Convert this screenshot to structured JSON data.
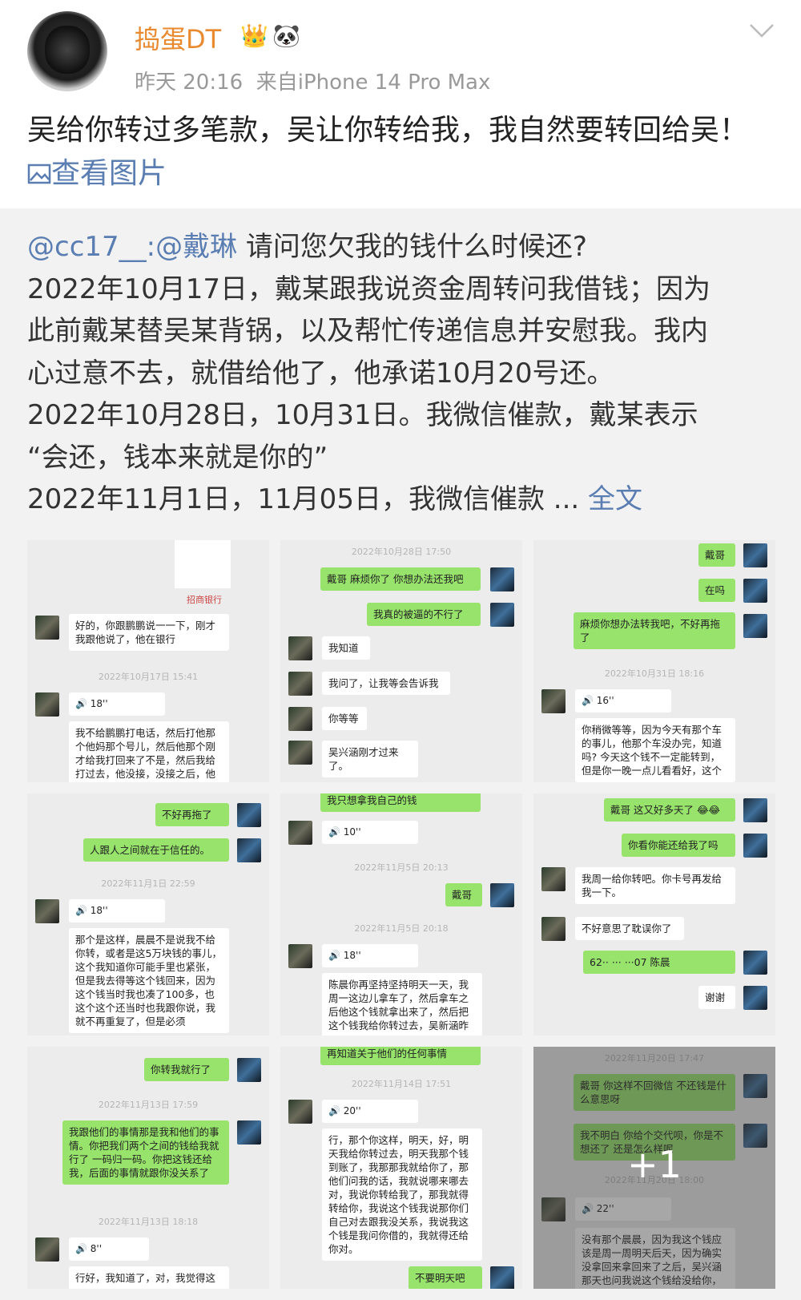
{
  "user": {
    "name": "捣蛋DT",
    "time": "昨天 20:16",
    "source": "来自iPhone 14 Pro Max"
  },
  "post": {
    "text": "吴给你转过多笔款，吴让你转给我，我自然要转回给吴！",
    "view_images": "查看图片"
  },
  "repost": {
    "mention": "@cc17__",
    "mention2": ":@戴琳",
    "line0": " 请问您欠我的钱什么时候还?",
    "line1": "2022年10月17日，戴某跟我说资金周转问我借钱；因为",
    "line2": "此前戴某替吴某背锅，以及帮忙传递信息并安慰我。我内",
    "line3": "心过意不去，就借给他了，他承诺10月20号还。",
    "line4": "2022年10月28日，10月31日。我微信催款，戴某表示",
    "line5": "“会还，钱本来就是你的”",
    "line6": "2022年11月1日，11月05日，我微信催款 ...",
    "full_text": "全文"
  },
  "tiles": {
    "t1": {
      "b1": "好的，你跟鹏鹏说一一下，刚才我跟他说了，他在银行",
      "time": "2022年10月17日 15:41",
      "voice": "18''",
      "b2": "我不给鹏鹏打电话，然后打他那个他妈那个号儿，然后他那个刚才给我打回来了不是，然后我给打过去，他没接，没接之后，他",
      "bank": "招商银行"
    },
    "t2": {
      "time": "2022年10月28日 17:50",
      "b1": "戴哥 麻烦你了 你想办法还我吧",
      "b2": "我真的被逼的不行了",
      "b3": "我知道",
      "b4": "我问了，让我等会告诉我",
      "b5": "你等等",
      "b6": "吴兴涵刚才过来了。"
    },
    "t3": {
      "b1": "戴哥",
      "b2": "在吗",
      "b3": "麻烦你想办法转我吧，不好再拖了",
      "time": "2022年10月31日 18:16",
      "voice": "16''",
      "b4": "你稍微等等，因为今天有那个车的事儿，他那个车没办完，知道吗? 今天这个钱不一定能转到，但是你一晚一点儿看看好，这个"
    },
    "t4": {
      "b1": "不好再拖了",
      "b2": "人跟人之间就在于信任的。",
      "time": "2022年11月1日 22:59",
      "voice": "18''",
      "b3": "那个是这样，晨晨不是说我不给你转，或者是这5万块钱的事儿，这个我知道你可能手里也紧张，但是我去得等这个钱回来，因为这个钱当时我也凑了100多，也这个这个还当时也我跟你说，我就不再重复了，但是必须"
    },
    "t5": {
      "top": "我只想拿我自己的钱",
      "voice": "10''",
      "time": "2022年11月5日 20:13",
      "b1": "戴哥",
      "time2": "2022年11月5日 20:18",
      "voice2": "18''",
      "b2": "陈晨你再坚持坚持明天一天，我周一这边儿拿车了，然后拿车之后他这个钱就拿出来了，然后把这个钱我给你转过去，吴新涵昨"
    },
    "t6": {
      "b1": "戴哥 这又好多天了 😂😂",
      "b2": "你看你能还给我了吗",
      "b3": "我周一给你转吧。你卡号再发给我一下。",
      "b4": "不好意思了耽误你了",
      "b5": "62·· ··· ···07 陈晨",
      "b6": "谢谢"
    },
    "t7": {
      "b1": "你转我就行了",
      "time": "2022年11月13日 17:59",
      "b2": "我跟他们的事情那是我和他们的事情。你把我们两个之间的钱给我就行了 一码归一码。你把这钱还给我，后面的事情就跟你没关系了",
      "time2": "2022年11月13日 18:18",
      "voice": "8''",
      "b3": "行好，我知道了，对，我觉得这"
    },
    "t8": {
      "top": "再知道关于他们的任何事情",
      "time": "2022年11月14日 17:51",
      "voice": "20''",
      "b1": "行，那个你这样，明天，好，明天我给你转过去，明天我那个钱到账了，我那那我就给你了，那他们问我的话，我就说哪来哪去对，我说你转给我了，那我就得转给你，我说这个钱我说那你们自己对去跟我没关系，我说我这个钱是我问你借的，我就得还给你对。",
      "b2": "不要明天吧"
    },
    "t9": {
      "time": "2022年11月20日 17:47",
      "b1": "戴哥 你这样不回微信 不还钱是什么意思呀",
      "b2": "我不明白 你给个交代呗，你是不想还了 还是怎么样呢",
      "time2": "2022年11月20日 18:00",
      "voice": "22''",
      "b3": "没有那个晨晨，因为我这个钱应该是周一周明天后天，因为确实没拿回来拿回来了之后，吴兴涵那天也问我说这个钱给没给你，",
      "more": "+1"
    }
  }
}
